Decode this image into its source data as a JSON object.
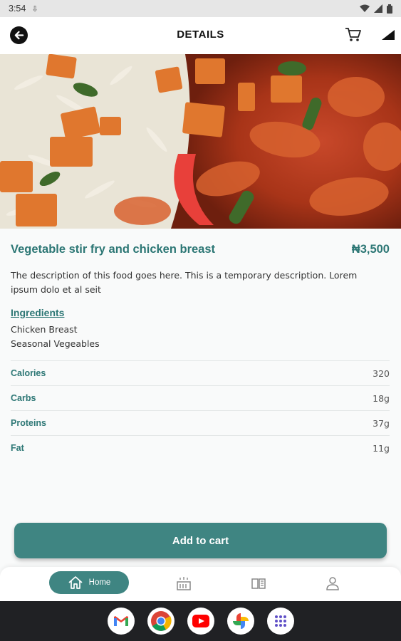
{
  "status_bar": {
    "time": "3:54",
    "download_indicator": "download-icon",
    "icons": [
      "wifi-icon",
      "signal-icon",
      "battery-icon"
    ]
  },
  "header": {
    "title": "DETAILS",
    "back_icon": "back-arrow-icon",
    "cart_icon": "cart-icon",
    "right_icon": "signal-icon"
  },
  "food": {
    "name": "Vegetable stir fry and chicken breast",
    "price": "₦3,500",
    "description": "The description of this food goes here. This is a temporary description. Lorem ipsum dolo et al seit",
    "ingredients_title": "Ingredients",
    "ingredients": [
      "Chicken Breast",
      "Seasonal Vegeables"
    ]
  },
  "nutrition": [
    {
      "label": "Calories",
      "value": "320"
    },
    {
      "label": "Carbs",
      "value": "18g"
    },
    {
      "label": "Proteins",
      "value": "37g"
    },
    {
      "label": "Fat",
      "value": "11g"
    }
  ],
  "actions": {
    "add_to_cart": "Add to cart"
  },
  "bottom_nav": {
    "home_label": "Home",
    "items": [
      "home-icon",
      "menu-icon",
      "book-icon",
      "profile-icon"
    ]
  },
  "dock": {
    "apps": [
      "gmail-icon",
      "chrome-icon",
      "youtube-icon",
      "photos-icon",
      "app-drawer-icon"
    ]
  },
  "colors": {
    "accent": "#2d7775",
    "button": "#3f8582",
    "background": "#f9fafa"
  }
}
